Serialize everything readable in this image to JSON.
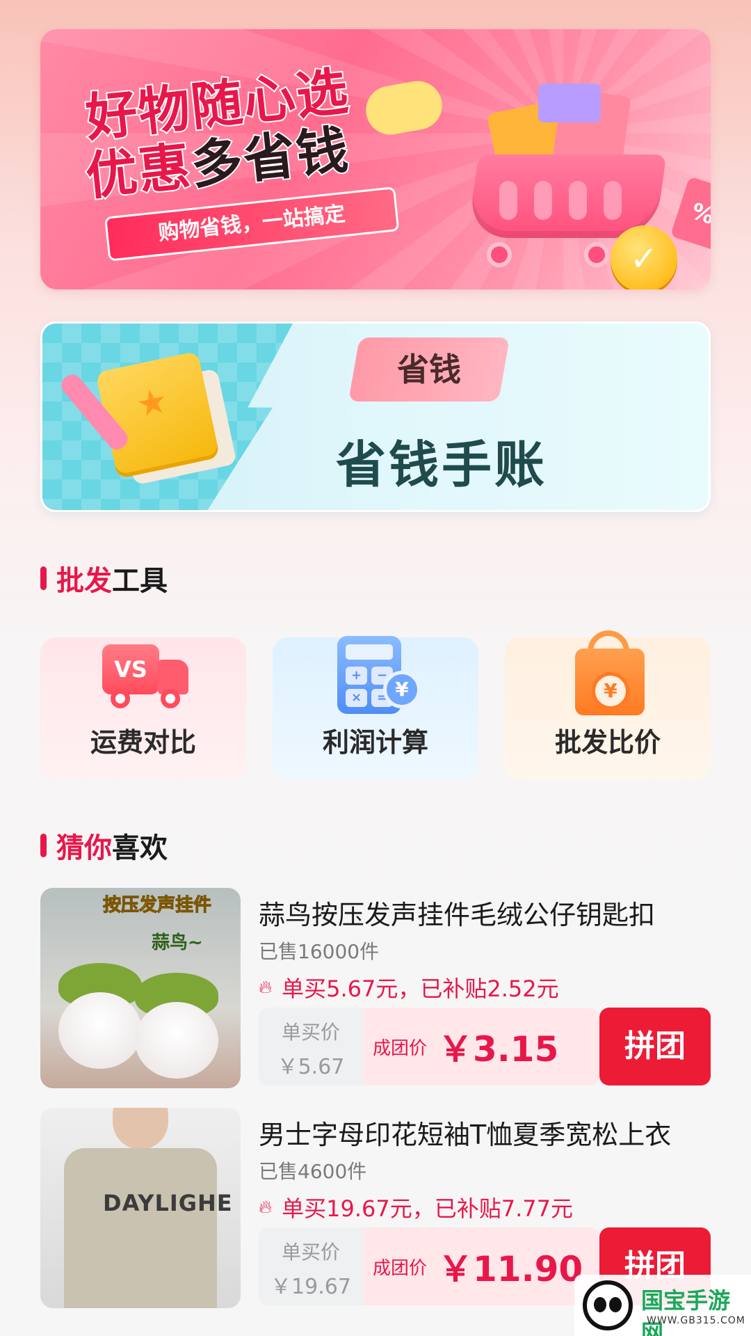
{
  "promo_banner": {
    "line1": "好物随心选",
    "line2_red": "优惠",
    "line2_dark": "多省钱",
    "ribbon": "购物省钱，一站搞定",
    "tag_symbol": "%",
    "coin_symbol": "✓"
  },
  "journal_banner": {
    "tag": "省钱",
    "title": "省钱手账"
  },
  "tools_section": {
    "title_accent": "批发",
    "title_rest": "工具",
    "items": [
      {
        "label": "运费对比",
        "icon": "shipping-truck-vs-icon",
        "icon_text": "VS"
      },
      {
        "label": "利润计算",
        "icon": "calculator-icon",
        "icon_text": "¥"
      },
      {
        "label": "批发比价",
        "icon": "shopping-bag-price-icon",
        "icon_text": "¥"
      }
    ]
  },
  "recommend_section": {
    "title_accent": "猜你",
    "title_rest": "喜欢"
  },
  "products": [
    {
      "title": "蒜鸟按压发声挂件毛绒公仔钥匙扣",
      "image_overlay_title": "按压发声挂件",
      "image_overlay_sub": "蒜鸟~",
      "sold": "已售16000件",
      "subsidy": "单买5.67元，已补贴2.52元",
      "single_label": "单买价",
      "single_price": "￥5.67",
      "group_label": "成团价",
      "group_price": "￥3.15",
      "button": "拼团"
    },
    {
      "title": "男士字母印花短袖T恤夏季宽松上衣",
      "image_overlay_title": "DAYLIGHE",
      "sold": "已售4600件",
      "subsidy": "单买19.67元，已补贴7.77元",
      "single_label": "单买价",
      "single_price": "￥19.67",
      "group_label": "成团价",
      "group_price": "￥11.90",
      "button": "拼团"
    }
  ],
  "watermark": {
    "name": "国宝手游网",
    "url": "WWW.GB315.COM"
  },
  "colors": {
    "accent": "#e8174a",
    "button": "#ec1b36",
    "journal_title": "#1f4b4c"
  }
}
